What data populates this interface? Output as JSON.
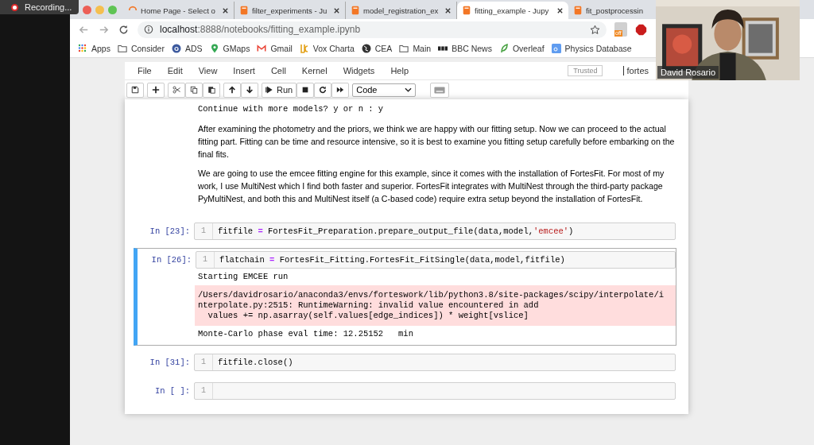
{
  "recording": {
    "label": "Recording..."
  },
  "browser": {
    "tabs": [
      {
        "title": "Home Page - Select o",
        "kind": "spinner",
        "selected": false
      },
      {
        "title": "filter_experiments - Ju",
        "kind": "notebook",
        "selected": false
      },
      {
        "title": "model_registration_ex",
        "kind": "notebook",
        "selected": false
      },
      {
        "title": "fitting_example - Jupy",
        "kind": "notebook",
        "selected": true
      },
      {
        "title": "fit_postprocessin",
        "kind": "notebook",
        "selected": false
      }
    ],
    "address": {
      "host": "localhost",
      "path": ":8888/notebooks/fitting_example.ipynb"
    },
    "extension_badge": "off",
    "bookmarks": [
      {
        "label": "Apps",
        "kind": "apps"
      },
      {
        "label": "Consider",
        "kind": "folder"
      },
      {
        "label": "ADS",
        "kind": "circle"
      },
      {
        "label": "GMaps",
        "kind": "pin"
      },
      {
        "label": "Gmail",
        "kind": "mail"
      },
      {
        "label": "Vox Charta",
        "kind": "logo"
      },
      {
        "label": "CEA",
        "kind": "globe"
      },
      {
        "label": "Main",
        "kind": "folder"
      },
      {
        "label": "BBC News",
        "kind": "bars"
      },
      {
        "label": "Overleaf",
        "kind": "leaf"
      },
      {
        "label": "Physics Database",
        "kind": "square"
      }
    ]
  },
  "notebook": {
    "menu": [
      "File",
      "Edit",
      "View",
      "Insert",
      "Cell",
      "Kernel",
      "Widgets",
      "Help"
    ],
    "trusted": "Trusted",
    "kernel": "fortes",
    "toolbar": [
      [
        {
          "kind": "save"
        }
      ],
      [
        {
          "kind": "add"
        }
      ],
      [
        {
          "kind": "cut"
        },
        {
          "kind": "copy"
        },
        {
          "kind": "paste"
        }
      ],
      [
        {
          "kind": "up"
        },
        {
          "kind": "down"
        }
      ],
      [
        {
          "kind": "run"
        },
        {
          "kind": "stop"
        },
        {
          "kind": "restart"
        },
        {
          "kind": "forward"
        }
      ],
      [
        {
          "kind": "select"
        }
      ],
      [
        {
          "kind": "keyboard"
        }
      ]
    ],
    "run_label": "Run",
    "cell_type": "Code",
    "cells": [
      {
        "kind": "stream",
        "text": "Continue with more models? y or n : y"
      },
      {
        "kind": "markdown",
        "paragraphs": [
          "After examining the photometry and the priors, we think we are happy with our fitting setup. Now we can proceed to the actual fitting part. Fitting can be time and resource intensive, so it is best to examine you fitting setup carefully before embarking on the final fits.",
          "We are going to use the emcee fitting engine for this example, since it comes with the installation of FortesFit. For most of my work, I use MultiNest which I find both faster and superior. FortesFit integrates with MultiNest through the third-party package PyMultiNest, and both this and MultiNest itself (a C-based code) require extra setup beyond the installation of FortesFit."
        ]
      },
      {
        "kind": "code",
        "prompt": "In [23]:",
        "selected": false,
        "line": "1",
        "tokens": [
          {
            "kind": "name",
            "text": "fitfile "
          },
          {
            "kind": "operator",
            "text": "="
          },
          {
            "kind": "name",
            "text": " FortesFit_Preparation.prepare_output_file(data,model,"
          },
          {
            "kind": "string",
            "text": "'emcee'"
          },
          {
            "kind": "name",
            "text": ")"
          }
        ]
      },
      {
        "kind": "code",
        "prompt": "In [26]:",
        "selected": true,
        "line": "1",
        "tokens": [
          {
            "kind": "name",
            "text": "flatchain "
          },
          {
            "kind": "operator",
            "text": "="
          },
          {
            "kind": "name",
            "text": " FortesFit_Fitting.FortesFit_FitSingle(data,model,fitfile)"
          }
        ],
        "outputs": [
          {
            "kind": "stdout",
            "text": "Starting EMCEE run"
          },
          {
            "kind": "stderr",
            "text": "/Users/davidrosario/anaconda3/envs/forteswork/lib/python3.8/site-packages/scipy/interpolate/i\nnterpolate.py:2515: RuntimeWarning: invalid value encountered in add\n  values += np.asarray(self.values[edge_indices]) * weight[vslice]"
          },
          {
            "kind": "stdout",
            "text": "Monte-Carlo phase eval time: 12.25152   min"
          }
        ]
      },
      {
        "kind": "code",
        "prompt": "In [31]:",
        "selected": false,
        "line": "1",
        "tokens": [
          {
            "kind": "name",
            "text": "fitfile.close()"
          }
        ]
      },
      {
        "kind": "code",
        "prompt": "In [ ]:",
        "selected": false,
        "line": "1"
      }
    ]
  },
  "video": {
    "name": "David Rosario"
  }
}
